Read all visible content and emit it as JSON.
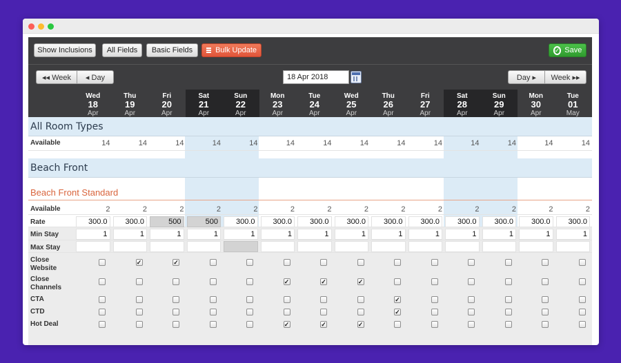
{
  "toolbar": {
    "show_inclusions": "Show Inclusions",
    "all_fields": "All Fields",
    "basic_fields": "Basic Fields",
    "bulk_update": "Bulk Update",
    "save": "Save"
  },
  "datebar": {
    "prev_week": "◂◂ Week",
    "prev_day": "◂ Day",
    "date_value": "18 Apr 2018",
    "next_day": "Day ▸",
    "next_week": "Week ▸▸"
  },
  "days": [
    {
      "name": "Wed",
      "num": "18",
      "month": "Apr",
      "weekend": false
    },
    {
      "name": "Thu",
      "num": "19",
      "month": "Apr",
      "weekend": false
    },
    {
      "name": "Fri",
      "num": "20",
      "month": "Apr",
      "weekend": false
    },
    {
      "name": "Sat",
      "num": "21",
      "month": "Apr",
      "weekend": true
    },
    {
      "name": "Sun",
      "num": "22",
      "month": "Apr",
      "weekend": true
    },
    {
      "name": "Mon",
      "num": "23",
      "month": "Apr",
      "weekend": false
    },
    {
      "name": "Tue",
      "num": "24",
      "month": "Apr",
      "weekend": false
    },
    {
      "name": "Wed",
      "num": "25",
      "month": "Apr",
      "weekend": false
    },
    {
      "name": "Thu",
      "num": "26",
      "month": "Apr",
      "weekend": false
    },
    {
      "name": "Fri",
      "num": "27",
      "month": "Apr",
      "weekend": false
    },
    {
      "name": "Sat",
      "num": "28",
      "month": "Apr",
      "weekend": true
    },
    {
      "name": "Sun",
      "num": "29",
      "month": "Apr",
      "weekend": true
    },
    {
      "name": "Mon",
      "num": "30",
      "month": "Apr",
      "weekend": false
    },
    {
      "name": "Tue",
      "num": "01",
      "month": "May",
      "weekend": false
    }
  ],
  "all_room_types": {
    "title": "All Room Types",
    "available_label": "Available",
    "available": [
      "14",
      "14",
      "14",
      "14",
      "14",
      "14",
      "14",
      "14",
      "14",
      "14",
      "14",
      "14",
      "14",
      "14"
    ]
  },
  "beach_front": {
    "title": "Beach Front",
    "room": {
      "title": "Beach Front Standard",
      "labels": {
        "available": "Available",
        "rate": "Rate",
        "min_stay": "Min Stay",
        "max_stay": "Max Stay",
        "close_website": "Close\nWebsite",
        "close_channels": "Close\nChannels",
        "cta": "CTA",
        "ctd": "CTD",
        "hot_deal": "Hot Deal"
      },
      "available": [
        "2",
        "2",
        "2",
        "2",
        "2",
        "2",
        "2",
        "2",
        "2",
        "2",
        "2",
        "2",
        "2",
        "2"
      ],
      "rate": [
        "300.0",
        "300.0",
        "500",
        "500",
        "300.0",
        "300.0",
        "300.0",
        "300.0",
        "300.0",
        "300.0",
        "300.0",
        "300.0",
        "300.0",
        "300.0"
      ],
      "rate_highlight": [
        false,
        false,
        true,
        true,
        false,
        false,
        false,
        false,
        false,
        false,
        false,
        false,
        false,
        false
      ],
      "min_stay": [
        "1",
        "1",
        "1",
        "1",
        "1",
        "1",
        "1",
        "1",
        "1",
        "1",
        "1",
        "1",
        "1",
        "1"
      ],
      "max_stay": [
        "",
        "",
        "",
        "",
        "",
        "",
        "",
        "",
        "",
        "",
        "",
        "",
        "",
        ""
      ],
      "max_stay_highlight": [
        false,
        false,
        false,
        false,
        true,
        false,
        false,
        false,
        false,
        false,
        false,
        false,
        false,
        false
      ],
      "close_website": [
        false,
        true,
        true,
        false,
        false,
        false,
        false,
        false,
        false,
        false,
        false,
        false,
        false,
        false
      ],
      "close_channels": [
        false,
        false,
        false,
        false,
        false,
        true,
        true,
        true,
        false,
        false,
        false,
        false,
        false,
        false
      ],
      "cta": [
        false,
        false,
        false,
        false,
        false,
        false,
        false,
        false,
        true,
        false,
        false,
        false,
        false,
        false
      ],
      "ctd": [
        false,
        false,
        false,
        false,
        false,
        false,
        false,
        false,
        true,
        false,
        false,
        false,
        false,
        false
      ],
      "hot_deal": [
        false,
        false,
        false,
        false,
        false,
        true,
        true,
        true,
        false,
        false,
        false,
        false,
        false,
        false
      ]
    }
  }
}
